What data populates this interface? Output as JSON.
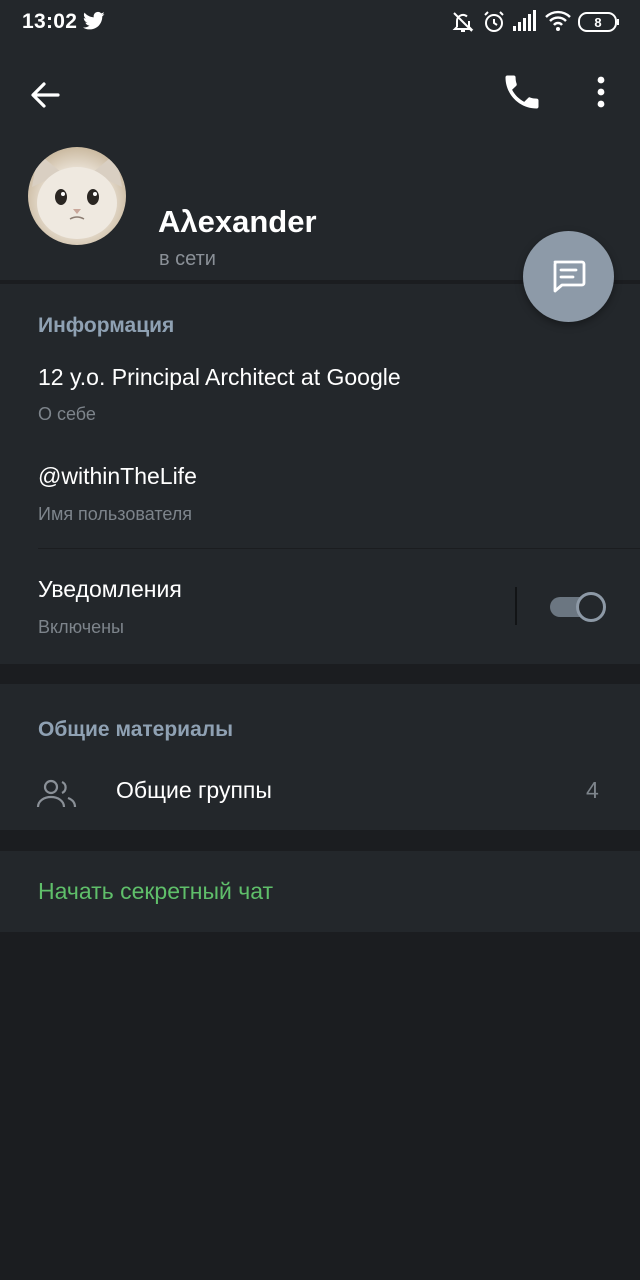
{
  "status_bar": {
    "time": "13:02",
    "battery": "8",
    "icons": [
      "twitter-icon",
      "mute-icon",
      "alarm-icon",
      "signal-icon",
      "wifi-icon",
      "battery-icon"
    ]
  },
  "toolbar": {
    "back_icon": "arrow-left-icon",
    "call_icon": "phone-icon",
    "more_icon": "more-vertical-icon"
  },
  "profile": {
    "name": "Aλexander",
    "status": "в сети"
  },
  "info": {
    "title": "Информация",
    "bio": "12 y.o. Principal Architect at Google",
    "bio_label": "О себе",
    "username": "@withinTheLife",
    "username_label": "Имя пользователя",
    "notifications": "Уведомления",
    "notifications_state": "Включены",
    "notifications_on": true
  },
  "shared": {
    "title": "Общие материалы",
    "groups_label": "Общие группы",
    "groups_count": "4"
  },
  "secret_chat": {
    "label": "Начать секретный чат"
  },
  "colors": {
    "background": "#1b1d20",
    "panel": "#23272b",
    "accent_title": "#8fa1b3",
    "secondary_text": "#7d848b",
    "fab": "#8d9aa8",
    "green": "#5fbf6a"
  }
}
